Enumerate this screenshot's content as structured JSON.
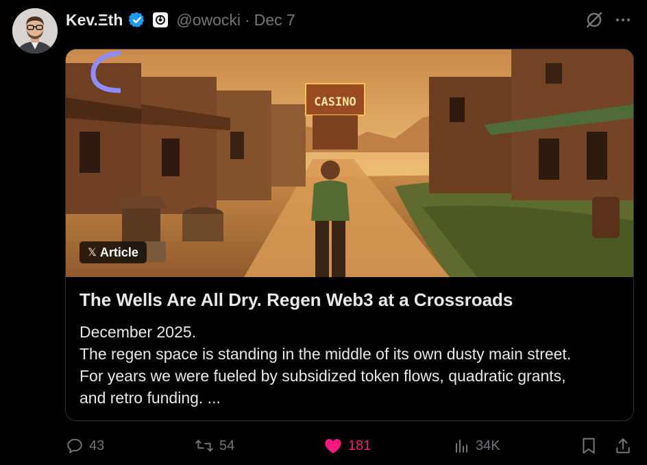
{
  "author": {
    "display_name": "Kev.Ξth",
    "handle": "@owocki",
    "date": "Dec 7",
    "separator": "·"
  },
  "article": {
    "badge_label": "Article",
    "badge_logo": "𝕏",
    "title": "The Wells Are All Dry. Regen Web3 at a Crossroads",
    "body_lines": [
      "December 2025.",
      "The regen space is standing in the middle of its own dusty main street.",
      "For years we were fueled by subsidized token flows, quadratic grants,",
      "and retro funding. ..."
    ],
    "image_sign_text": "CASINO"
  },
  "actions": {
    "replies": "43",
    "reposts": "54",
    "likes": "181",
    "views": "34K"
  },
  "icons": {
    "verified": "verified-badge-icon",
    "affiliation": "affiliation-badge-icon",
    "grok": "grok-icon",
    "more": "more-icon",
    "reply": "reply-icon",
    "repost": "repost-icon",
    "like": "heart-icon",
    "views": "views-icon",
    "bookmark": "bookmark-icon",
    "share": "share-icon"
  },
  "colors": {
    "background": "#000000",
    "text_primary": "#e7e9ea",
    "text_secondary": "#71767b",
    "verified_blue": "#1d9bf0",
    "like_pink": "#f91880",
    "border": "#2f3336"
  }
}
